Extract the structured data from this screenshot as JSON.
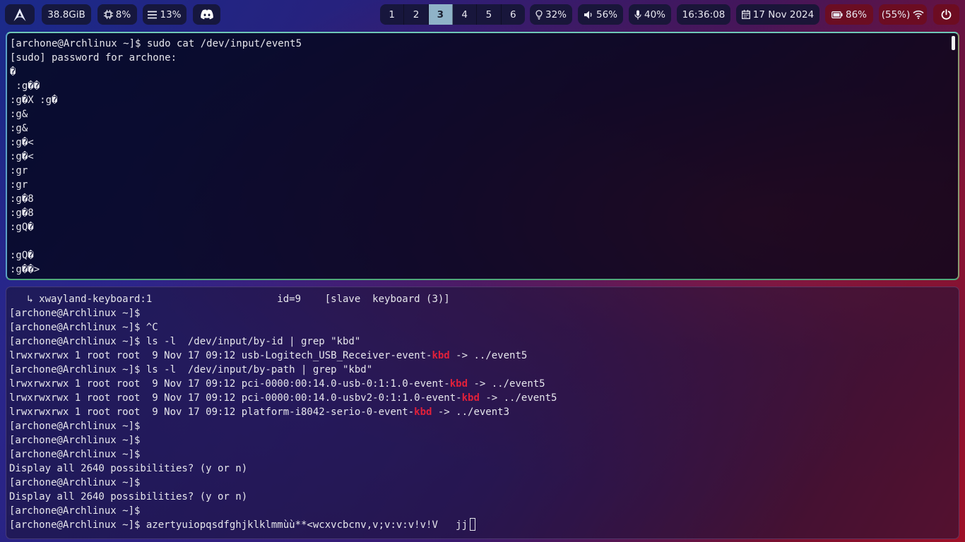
{
  "topbar": {
    "memory": "38.8GiB",
    "cpu": "8%",
    "mem_percent": "13%",
    "workspaces": [
      "1",
      "2",
      "3",
      "4",
      "5",
      "6"
    ],
    "active_workspace": "3",
    "brightness": "32%",
    "volume": "56%",
    "mic": "40%",
    "time": "16:36:08",
    "date": "17 Nov 2024",
    "battery": "86%",
    "wifi": "(55%)",
    "colors": {
      "bar_bg": "#14163a",
      "active_workspace": "#8fb3c8",
      "power_bg": "#6e0c1e"
    }
  },
  "terminal_top": {
    "lines": [
      "[archone@Archlinux ~]$ sudo cat /dev/input/event5",
      "[sudo] password for archone:",
      "�",
      " :g��",
      ":g�X :g�",
      ":g&",
      ":g&",
      ":g�<",
      ":g�<",
      ":gr",
      ":gr",
      ":g�8",
      ":g�8",
      ":gQ�",
      "",
      ":gQ�",
      ":g��>"
    ]
  },
  "terminal_bottom": {
    "highlight_color": "#e0203a",
    "lines": [
      {
        "parts": [
          "   ↳ xwayland-keyboard:1                     id=9    [slave  keyboard (3)]"
        ]
      },
      {
        "parts": [
          "[archone@Archlinux ~]$"
        ]
      },
      {
        "parts": [
          "[archone@Archlinux ~]$ ^C"
        ]
      },
      {
        "parts": [
          "[archone@Archlinux ~]$ ls -l  /dev/input/by-id | grep \"kbd\""
        ]
      },
      {
        "parts": [
          "lrwxrwxrwx 1 root root  9 Nov 17 09:12 usb-Logitech_USB_Receiver-event-",
          "kbd",
          " -> ../event5"
        ]
      },
      {
        "parts": [
          "[archone@Archlinux ~]$ ls -l  /dev/input/by-path | grep \"kbd\""
        ]
      },
      {
        "parts": [
          "lrwxrwxrwx 1 root root  9 Nov 17 09:12 pci-0000:00:14.0-usb-0:1:1.0-event-",
          "kbd",
          " -> ../event5"
        ]
      },
      {
        "parts": [
          "lrwxrwxrwx 1 root root  9 Nov 17 09:12 pci-0000:00:14.0-usbv2-0:1:1.0-event-",
          "kbd",
          " -> ../event5"
        ]
      },
      {
        "parts": [
          "lrwxrwxrwx 1 root root  9 Nov 17 09:12 platform-i8042-serio-0-event-",
          "kbd",
          " -> ../event3"
        ]
      },
      {
        "parts": [
          "[archone@Archlinux ~]$"
        ]
      },
      {
        "parts": [
          "[archone@Archlinux ~]$"
        ]
      },
      {
        "parts": [
          "[archone@Archlinux ~]$"
        ]
      },
      {
        "parts": [
          "Display all 2640 possibilities? (y or n)"
        ]
      },
      {
        "parts": [
          "[archone@Archlinux ~]$"
        ]
      },
      {
        "parts": [
          "Display all 2640 possibilities? (y or n)"
        ]
      },
      {
        "parts": [
          "[archone@Archlinux ~]$"
        ]
      },
      {
        "parts": [
          "[archone@Archlinux ~]$ azertyuiopqsdfghjklklmmùù**<wcxvcbcnv,v;v:v:v!v!V   jj"
        ],
        "cursor": true
      }
    ]
  }
}
